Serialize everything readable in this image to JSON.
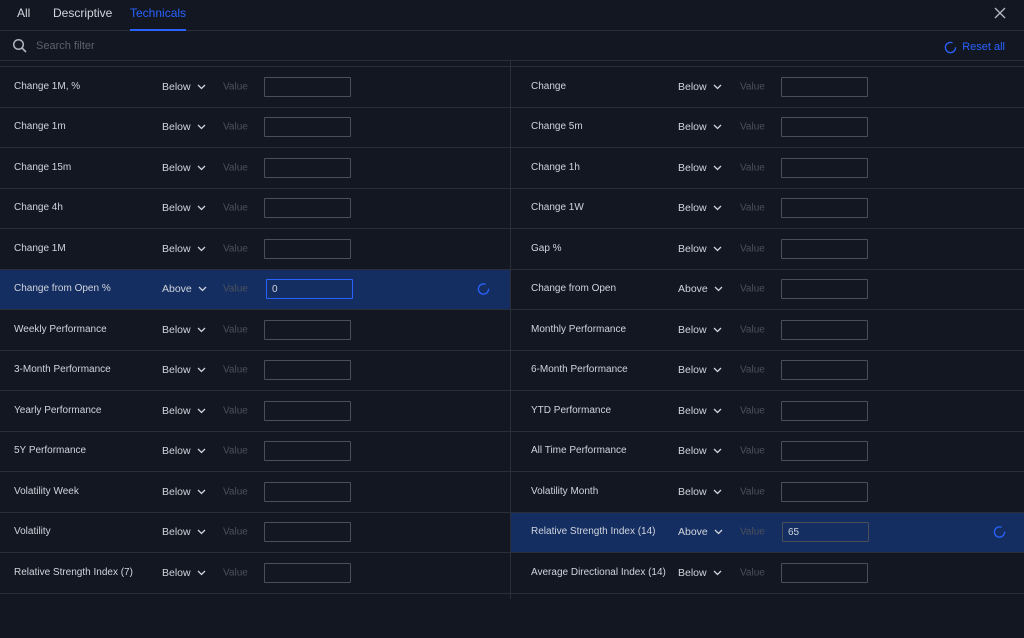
{
  "tabs": [
    {
      "label": "All"
    },
    {
      "label": "Descriptive"
    },
    {
      "label": "Technicals"
    }
  ],
  "search": {
    "placeholder": "Search filter"
  },
  "reset_all_label": "Reset all",
  "left_rows": [
    {
      "label": "",
      "op": "",
      "value_label": "",
      "value": ""
    },
    {
      "label": "Change 1M, %",
      "op": "Below",
      "value_label": "Value",
      "value": ""
    },
    {
      "label": "Change 1m",
      "op": "Below",
      "value_label": "Value",
      "value": ""
    },
    {
      "label": "Change 15m",
      "op": "Below",
      "value_label": "Value",
      "value": ""
    },
    {
      "label": "Change 4h",
      "op": "Below",
      "value_label": "Value",
      "value": ""
    },
    {
      "label": "Change 1M",
      "op": "Below",
      "value_label": "Value",
      "value": ""
    },
    {
      "label": "Change from Open %",
      "op": "Above",
      "value_label": "Value",
      "value": "0"
    },
    {
      "label": "Weekly Performance",
      "op": "Below",
      "value_label": "Value",
      "value": ""
    },
    {
      "label": "3-Month Performance",
      "op": "Below",
      "value_label": "Value",
      "value": ""
    },
    {
      "label": "Yearly Performance",
      "op": "Below",
      "value_label": "Value",
      "value": ""
    },
    {
      "label": "5Y Performance",
      "op": "Below",
      "value_label": "Value",
      "value": ""
    },
    {
      "label": "Volatility Week",
      "op": "Below",
      "value_label": "Value",
      "value": ""
    },
    {
      "label": "Volatility",
      "op": "Below",
      "value_label": "Value",
      "value": ""
    },
    {
      "label": "Relative Strength Index (7)",
      "op": "Below",
      "value_label": "Value",
      "value": ""
    }
  ],
  "right_rows": [
    {
      "label": "",
      "op": "",
      "value_label": "",
      "value": ""
    },
    {
      "label": "Change",
      "op": "Below",
      "value_label": "Value",
      "value": ""
    },
    {
      "label": "Change 5m",
      "op": "Below",
      "value_label": "Value",
      "value": ""
    },
    {
      "label": "Change 1h",
      "op": "Below",
      "value_label": "Value",
      "value": ""
    },
    {
      "label": "Change 1W",
      "op": "Below",
      "value_label": "Value",
      "value": ""
    },
    {
      "label": "Gap %",
      "op": "Below",
      "value_label": "Value",
      "value": ""
    },
    {
      "label": "Change from Open",
      "op": "Above",
      "value_label": "Value",
      "value": ""
    },
    {
      "label": "Monthly Performance",
      "op": "Below",
      "value_label": "Value",
      "value": ""
    },
    {
      "label": "6-Month Performance",
      "op": "Below",
      "value_label": "Value",
      "value": ""
    },
    {
      "label": "YTD Performance",
      "op": "Below",
      "value_label": "Value",
      "value": ""
    },
    {
      "label": "All Time Performance",
      "op": "Below",
      "value_label": "Value",
      "value": ""
    },
    {
      "label": "Volatility Month",
      "op": "Below",
      "value_label": "Value",
      "value": ""
    },
    {
      "label": "Relative Strength Index (14)",
      "op": "Above",
      "value_label": "Value",
      "value": "65"
    },
    {
      "label": "Average Directional Index (14)",
      "op": "Below",
      "value_label": "Value",
      "value": ""
    }
  ],
  "colors": {
    "accent": "#2962ff",
    "active_row": "#142e61",
    "background": "#131722"
  }
}
